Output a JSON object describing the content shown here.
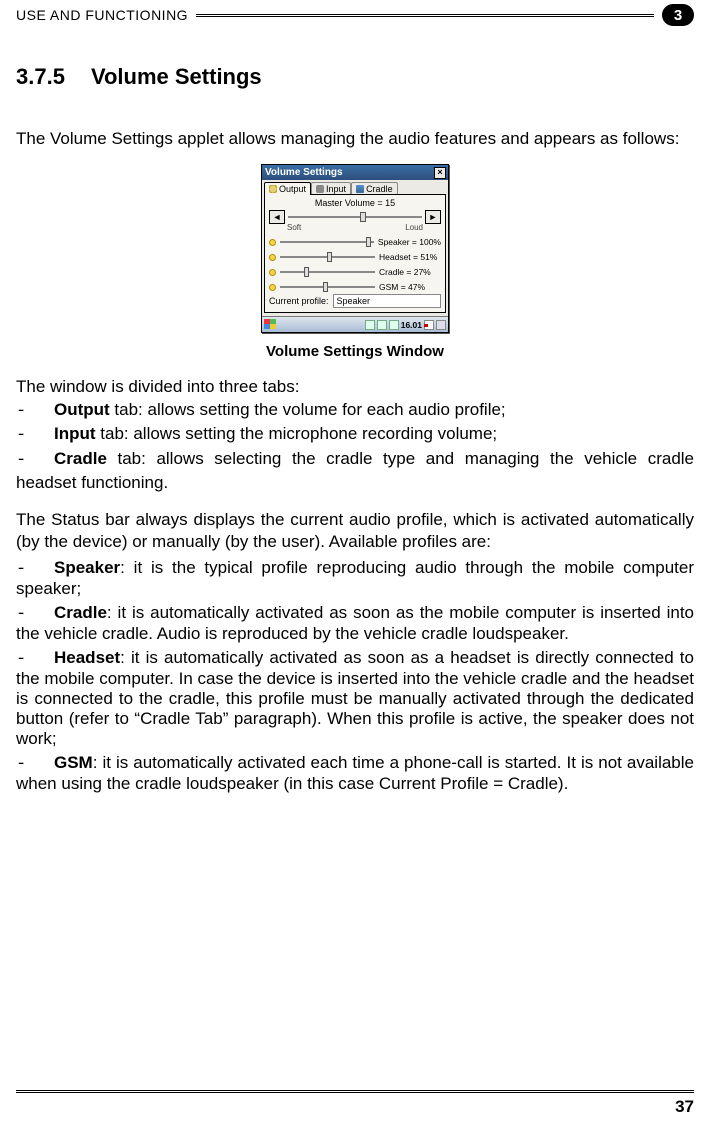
{
  "header": {
    "title": "USE AND FUNCTIONING",
    "chapter_badge": "3"
  },
  "section": {
    "number": "3.7.5",
    "title": "Volume Settings"
  },
  "intro": "The Volume Settings applet allows managing the audio features and appears as follows:",
  "screenshot": {
    "window_title": "Volume Settings",
    "close_glyph": "×",
    "tabs": {
      "output": "Output",
      "input": "Input",
      "cradle": "Cradle"
    },
    "master_label": "Master Volume = 15",
    "arrow_left": "◄",
    "arrow_right": "►",
    "soft": "Soft",
    "loud": "Loud",
    "channels": {
      "speaker": "Speaker = 100%",
      "headset": "Headset = 51%",
      "cradle": "Cradle = 27%",
      "gsm": "GSM = 47%"
    },
    "current_profile_label": "Current profile:",
    "current_profile_value": "Speaker",
    "taskbar_time": "16.01"
  },
  "figure_caption": "Volume Settings Window",
  "tabs_intro": "The window is divided into three tabs:",
  "tab_items": {
    "output_bold": "Output",
    "output_rest": " tab: allows setting the volume for each audio profile;",
    "input_bold": "Input",
    "input_rest": " tab: allows setting the microphone recording volume;",
    "cradle_bold": "Cradle",
    "cradle_rest": " tab: allows selecting the cradle type and managing the vehicle cradle headset functioning."
  },
  "status_para": "The Status bar always displays the current audio profile, which is activated automatically (by the device) or manually (by the user). Available profiles are:",
  "profiles": {
    "speaker_bold": "Speaker",
    "speaker_rest": ": it is the typical profile reproducing audio through the mobile computer speaker;",
    "cradle_bold": "Cradle",
    "cradle_rest": ": it is automatically activated as soon as the mobile computer is inserted into the vehicle cradle. Audio is reproduced by the vehicle cradle loudspeaker.",
    "headset_bold": "Headset",
    "headset_rest": ": it is automatically activated as soon as a headset is directly connected to the mobile computer. In case the device is inserted into the vehicle cradle and the headset is connected to the cradle, this profile must be manually activated through the dedicated button (refer to “Cradle Tab” paragraph). When this profile is active, the speaker does not work;",
    "gsm_bold": "GSM",
    "gsm_rest": ": it is automatically activated each time a phone-call is started. It is not available when using the cradle loudspeaker (in this case Current Profile = Cradle)."
  },
  "dash": "-",
  "footer_page": "37"
}
